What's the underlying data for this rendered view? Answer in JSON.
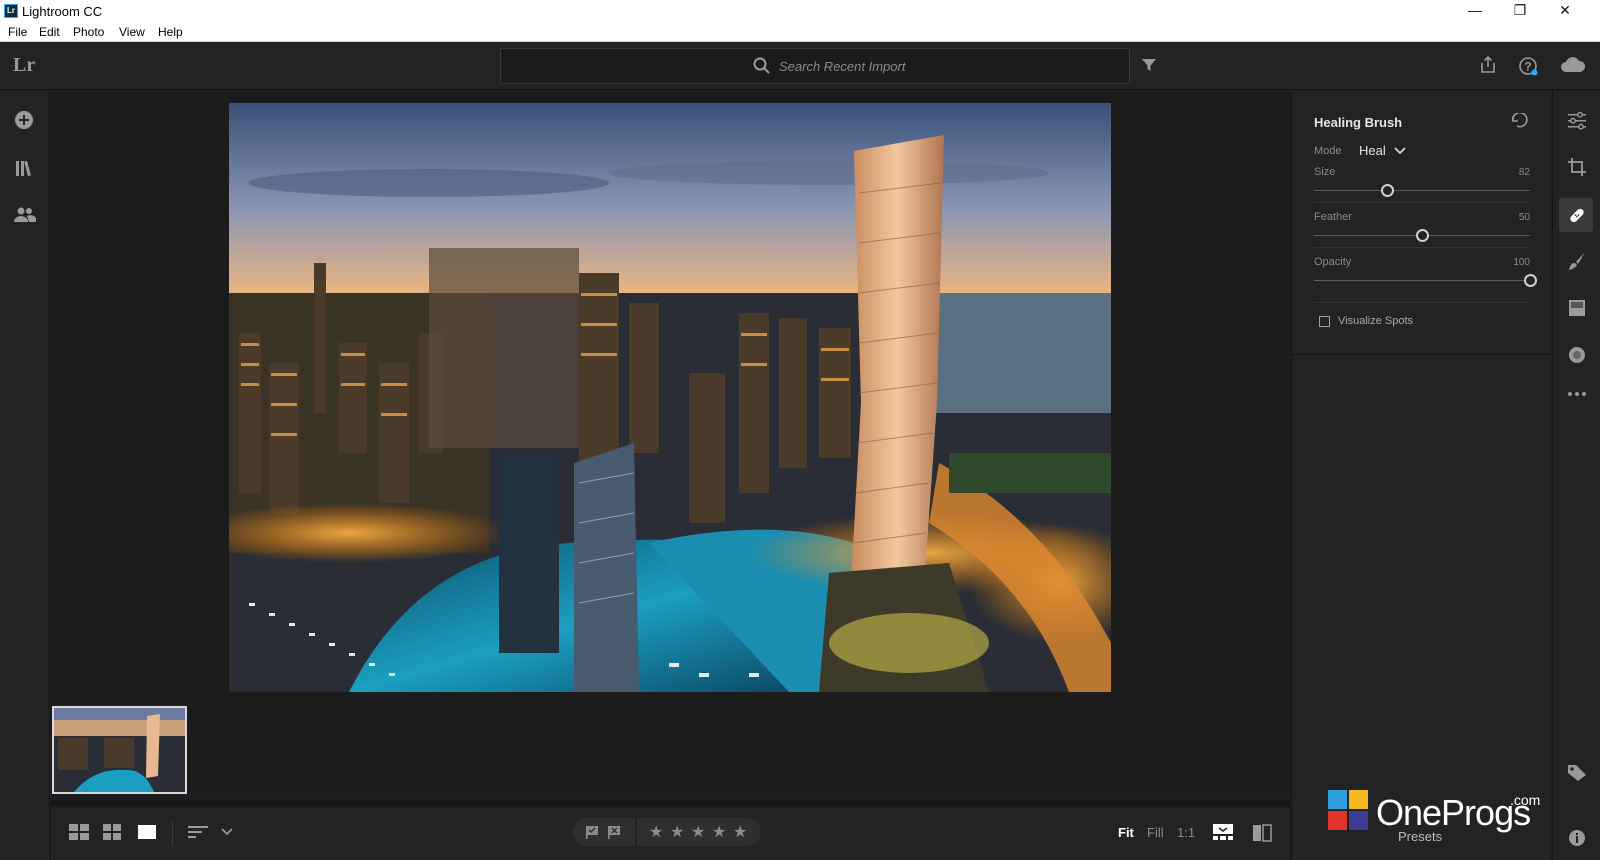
{
  "app": {
    "title": "Lightroom CC",
    "logo_text": "Lr"
  },
  "window_controls": {
    "minimize": "—",
    "restore": "❐",
    "close": "✕"
  },
  "menu": [
    "File",
    "Edit",
    "Photo",
    "View",
    "Help"
  ],
  "topbar": {
    "brand": "Lr",
    "search_placeholder": "Search Recent Import"
  },
  "healing_brush": {
    "title": "Healing Brush",
    "mode_label": "Mode",
    "mode_value": "Heal",
    "size_label": "Size",
    "size_value": "82",
    "feather_label": "Feather",
    "feather_value": "50",
    "opacity_label": "Opacity",
    "opacity_value": "100",
    "visualize_label": "Visualize Spots",
    "visualize_checked": false
  },
  "sliders": {
    "size": 0.34,
    "feather": 0.5,
    "opacity": 1.0
  },
  "bottombar": {
    "stars": [
      "★",
      "★",
      "★",
      "★",
      "★"
    ],
    "zoom": {
      "fit": "Fit",
      "fill": "Fill",
      "one_to_one": "1:1"
    }
  },
  "watermark": {
    "brand": "OneProgs",
    "tld": ".com",
    "presets": "Presets"
  },
  "colors": {
    "panel": "#232323",
    "canvas": "#1c1c1c",
    "accent": "#31a8ff"
  }
}
